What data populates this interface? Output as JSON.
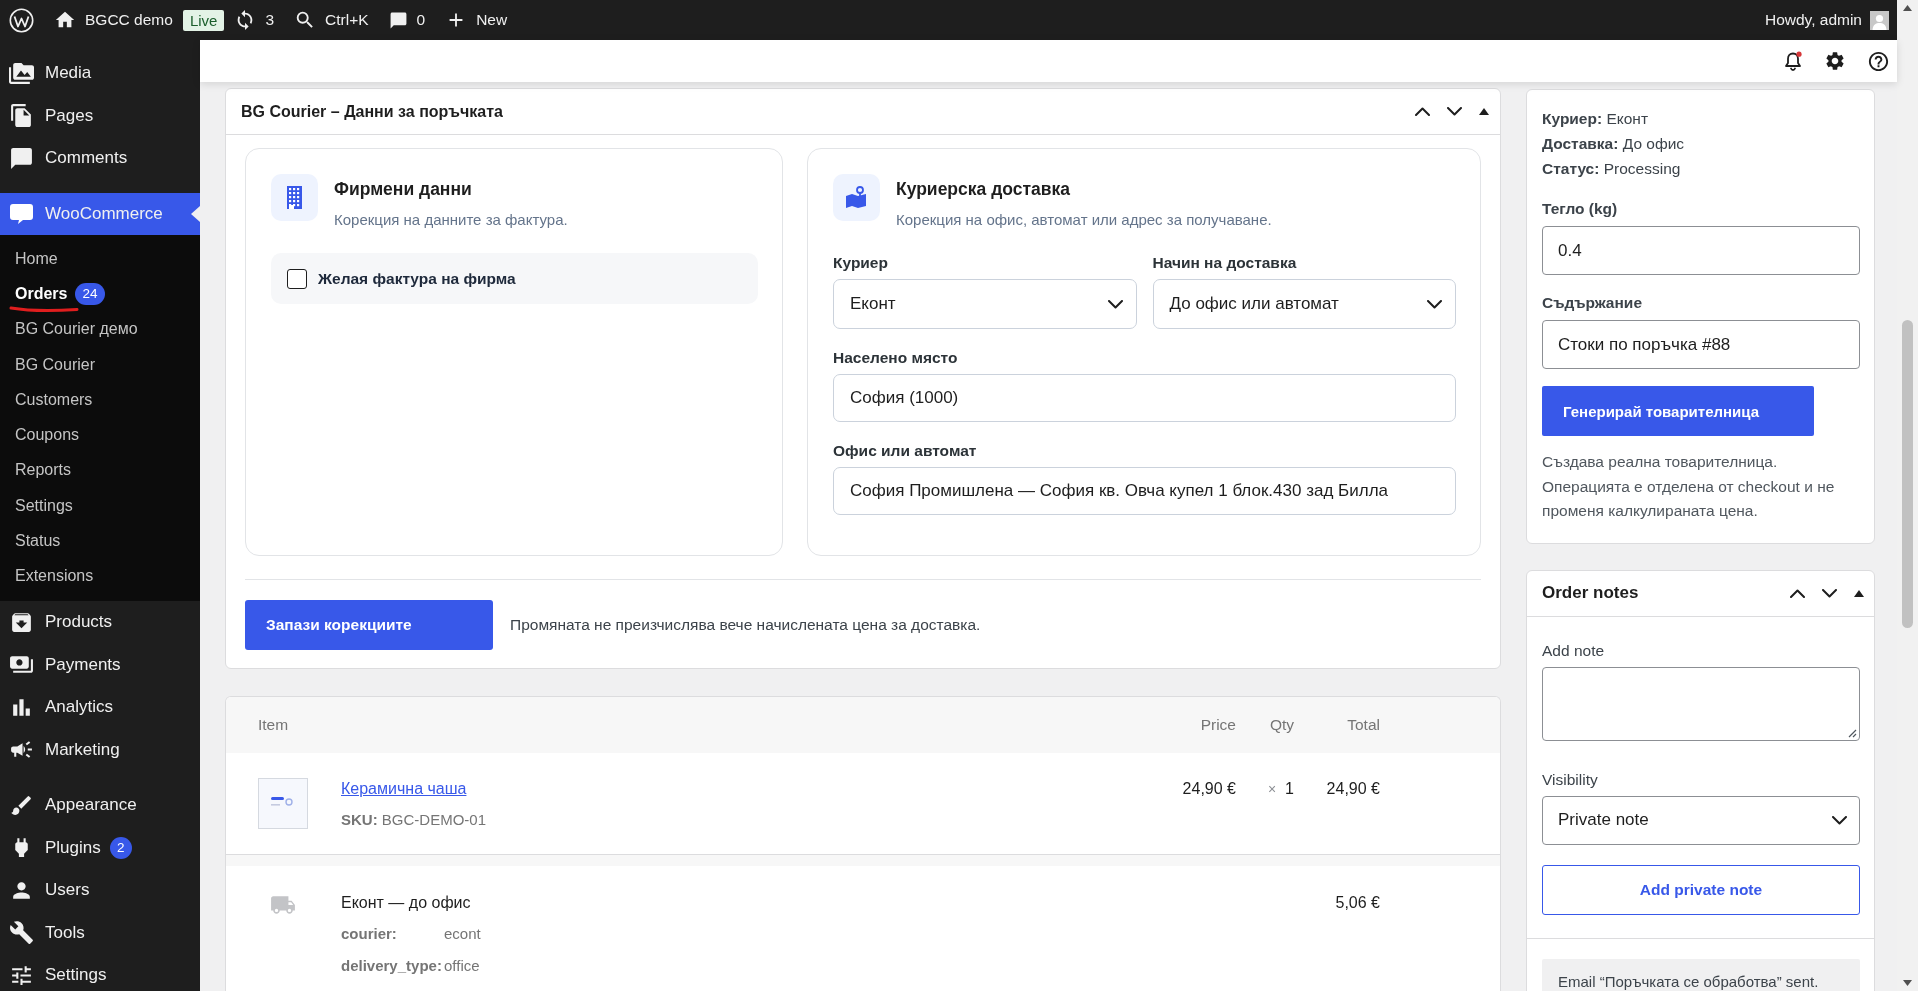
{
  "admin_bar": {
    "site_name": "BGCC demo",
    "site_badge": "Live",
    "updates": "3",
    "search_shortcut": "Ctrl+K",
    "comments": "0",
    "new_label": "New",
    "greeting": "Howdy, admin"
  },
  "sidebar": {
    "groups": [
      {
        "items": [
          {
            "label": "Media",
            "selected": false
          },
          {
            "label": "Pages",
            "selected": false
          },
          {
            "label": "Comments",
            "selected": false
          }
        ]
      },
      {
        "items": [
          {
            "label": "WooCommerce",
            "selected": true,
            "children": [
              {
                "label": "Home",
                "selected": false
              },
              {
                "label": "Orders",
                "selected": true,
                "badge": "24"
              },
              {
                "label": "BG Courier демо",
                "selected": false
              },
              {
                "label": "BG Courier",
                "selected": false
              },
              {
                "label": "Customers",
                "selected": false
              },
              {
                "label": "Coupons",
                "selected": false
              },
              {
                "label": "Reports",
                "selected": false
              },
              {
                "label": "Settings",
                "selected": false
              },
              {
                "label": "Status",
                "selected": false
              },
              {
                "label": "Extensions",
                "selected": false
              }
            ]
          },
          {
            "label": "Products",
            "selected": false
          },
          {
            "label": "Payments",
            "selected": false
          },
          {
            "label": "Analytics",
            "selected": false
          },
          {
            "label": "Marketing",
            "selected": false
          }
        ]
      },
      {
        "items": [
          {
            "label": "Appearance",
            "selected": false
          },
          {
            "label": "Plugins",
            "selected": false,
            "badge": "2"
          },
          {
            "label": "Users",
            "selected": false
          },
          {
            "label": "Tools",
            "selected": false
          },
          {
            "label": "Settings",
            "selected": false
          }
        ]
      }
    ]
  },
  "courier_box": {
    "title": "BG Courier – Данни за поръчката",
    "company_card": {
      "title": "Фирмени данни",
      "subtitle": "Корекция на данните за фактура.",
      "invoice_checkbox": {
        "label": "Желая фактура на фирма",
        "checked": false
      }
    },
    "delivery_card": {
      "title": "Куриерска доставка",
      "subtitle": "Корекция на офис, автомат или адрес за получаване.",
      "fields": [
        {
          "kind": "select",
          "label": "Куриер",
          "value": "Еконт"
        },
        {
          "kind": "select",
          "label": "Начин на доставка",
          "value": "До офис или автомат"
        },
        {
          "kind": "text",
          "label": "Населено място",
          "value": "София (1000)"
        },
        {
          "kind": "text",
          "label": "Офис или автомат",
          "value": "София Промишлена — София кв. Овча купел 1 блок.430 зад Билла"
        }
      ]
    },
    "save_button": "Запази корекциите",
    "note": "Промяната не преизчислява вече начислената цена за доставка."
  },
  "items_table": {
    "columns": [
      "Item",
      "Price",
      "Qty",
      "Total"
    ],
    "rows": [
      {
        "kind": "product",
        "name": "Керамична чаша",
        "sku": "**SKU:** BGC-DEMO-01",
        "price": "24,90 €",
        "qty_sign": "×",
        "qty": "1",
        "total": "24,90 €"
      },
      {
        "kind": "shipping",
        "name": "Еконт — до офис",
        "total": "5,06 €",
        "meta": [
          {
            "key": "courier:",
            "value": "econt"
          },
          {
            "key": "delivery_type:",
            "value": "office"
          }
        ]
      }
    ]
  },
  "shipment_box": {
    "details": [
      "**Куриер:** Еконт",
      "**Доставка:** До офис",
      "**Статус:** Processing"
    ],
    "weight": {
      "label": "Тегло (kg)",
      "value": "0.4"
    },
    "contents": {
      "label": "Съдържание",
      "value": "Стоки по поръчка #88"
    },
    "generate_button": "Генерирай товарителница",
    "help": "Създава реална товарителница. Операцията е отделена от checkout и не променя калкулираната цена."
  },
  "order_notes": {
    "title": "Order notes",
    "add_note_label": "Add note",
    "visibility_label": "Visibility",
    "visibility_value": "Private note",
    "add_button": "Add private note",
    "notes": [
      "Email “Поръчката се обработва” sent."
    ]
  }
}
